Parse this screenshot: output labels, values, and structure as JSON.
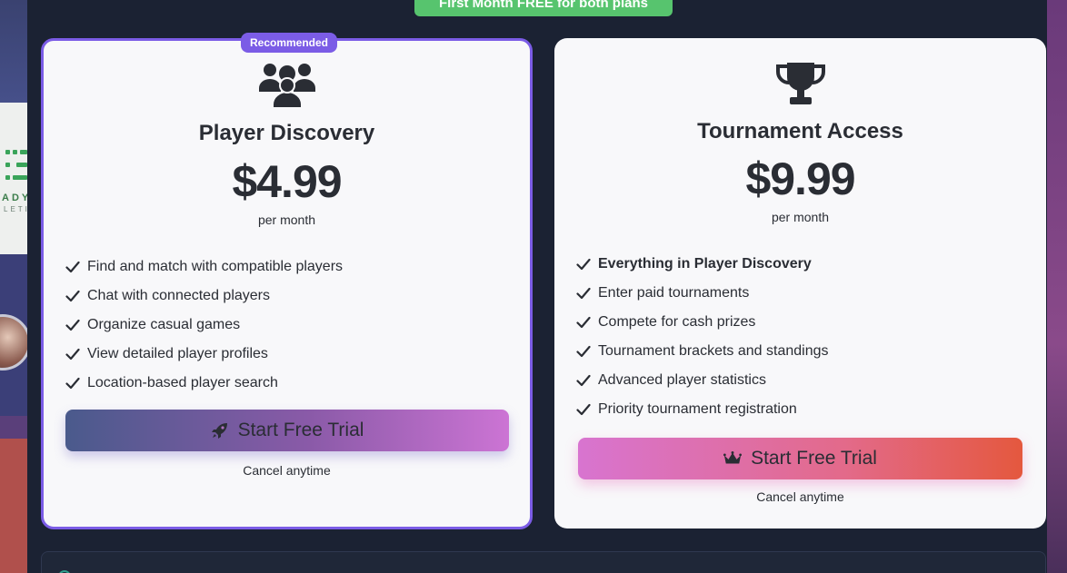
{
  "promo_banner": "First Month FREE for both plans",
  "plans": [
    {
      "badge": "Recommended",
      "icon": "users-icon",
      "title": "Player Discovery",
      "price": "$4.99",
      "period": "per month",
      "features": [
        "Find and match with compatible players",
        "Chat with connected players",
        "Organize casual games",
        "View detailed player profiles",
        "Location-based player search"
      ],
      "cta_label": "Start Free Trial",
      "cta_icon": "rocket-icon",
      "cancel_note": "Cancel anytime"
    },
    {
      "icon": "trophy-icon",
      "title": "Tournament Access",
      "price": "$9.99",
      "period": "per month",
      "features": [
        "Everything in Player Discovery",
        "Enter paid tournaments",
        "Compete for cash prizes",
        "Tournament brackets and standings",
        "Advanced player statistics",
        "Priority tournament registration"
      ],
      "cta_label": "Start Free Trial",
      "cta_icon": "crown-icon",
      "cancel_note": "Cancel anytime"
    }
  ],
  "background": {
    "logo_text": "ADY",
    "logo_subtext": "LETI"
  },
  "colors": {
    "accent": "#7b5ce6",
    "promo": "#57c46e",
    "backdrop": "#1b2233",
    "card": "#f8f8fa"
  }
}
